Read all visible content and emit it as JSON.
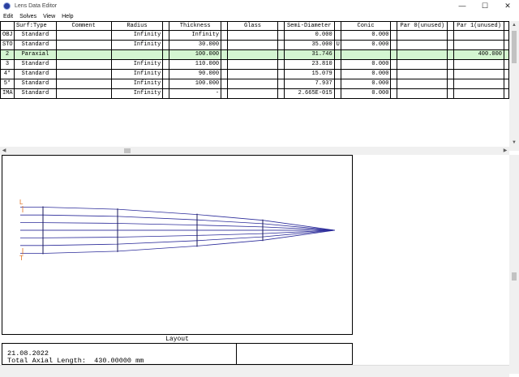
{
  "window": {
    "title": "Lens Data Editor",
    "controls": {
      "minimize": "—",
      "maximize": "☐",
      "close": "✕"
    }
  },
  "menu": [
    "Edit",
    "Solves",
    "View",
    "Help"
  ],
  "table": {
    "headers": {
      "surf_type": "Surf:Type",
      "comment": "Comment",
      "radius": "Radius",
      "thickness": "Thickness",
      "glass": "Glass",
      "semi_diameter": "Semi-Diameter",
      "conic": "Conic",
      "par0": "Par 0(unused)",
      "par1": "Par 1(unused)"
    },
    "rows": [
      {
        "id": "OBJ",
        "type": "Standard",
        "comment": "",
        "radius": "Infinity",
        "thickness": "Infinity",
        "glass": "",
        "semi_diameter": "0.000",
        "sd_solve": "",
        "conic": "0.000",
        "par0": "",
        "par1": ""
      },
      {
        "id": "STO",
        "type": "Standard",
        "comment": "",
        "radius": "Infinity",
        "thickness": "30.000",
        "glass": "",
        "semi_diameter": "35.000",
        "sd_solve": "U",
        "conic": "0.000",
        "par0": "",
        "par1": ""
      },
      {
        "id": "2",
        "type": "Paraxial",
        "comment": "",
        "radius": "",
        "thickness": "100.000",
        "glass": "",
        "semi_diameter": "31.746",
        "sd_solve": "",
        "conic": "",
        "par0": "",
        "par1": "400.000"
      },
      {
        "id": "3",
        "type": "Standard",
        "comment": "",
        "radius": "Infinity",
        "thickness": "110.000",
        "glass": "",
        "semi_diameter": "23.810",
        "sd_solve": "",
        "conic": "0.000",
        "par0": "",
        "par1": ""
      },
      {
        "id": "4*",
        "type": "Standard",
        "comment": "",
        "radius": "Infinity",
        "thickness": "90.000",
        "glass": "",
        "semi_diameter": "15.079",
        "sd_solve": "",
        "conic": "0.000",
        "par0": "",
        "par1": ""
      },
      {
        "id": "5*",
        "type": "Standard",
        "comment": "",
        "radius": "Infinity",
        "thickness": "100.000",
        "glass": "",
        "semi_diameter": "7.937",
        "sd_solve": "",
        "conic": "0.000",
        "par0": "",
        "par1": ""
      },
      {
        "id": "IMA",
        "type": "Standard",
        "comment": "",
        "radius": "Infinity",
        "thickness": "-",
        "glass": "",
        "semi_diameter": "2.665E-015",
        "sd_solve": "",
        "conic": "0.000",
        "par0": "",
        "par1": ""
      }
    ],
    "highlight_row_color": "#d4f5d1"
  },
  "layout": {
    "title": "Layout",
    "date": "21.08.2022",
    "total_axial_length": "Total Axial Length:  430.00000 mm",
    "axis_markers": {
      "top": "L",
      "bottom": "T"
    },
    "ray_color": "#2b2b9a",
    "marker_color": "#e07020"
  }
}
